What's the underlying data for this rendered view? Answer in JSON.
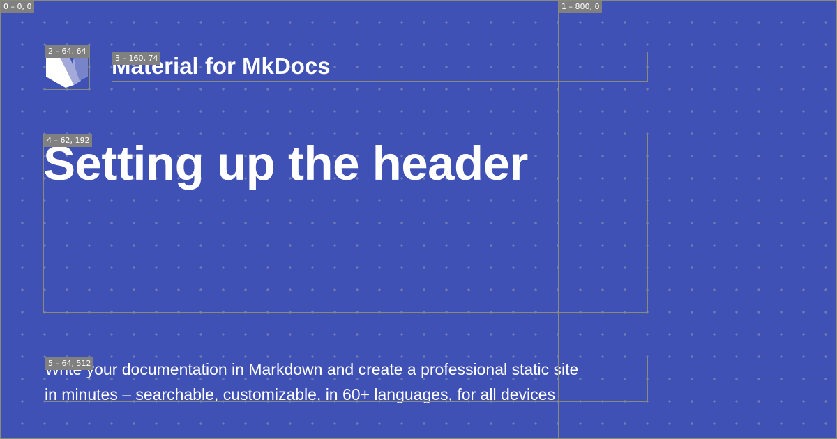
{
  "background_color": "#3f51b5",
  "site_name": "Material for MkDocs",
  "page_title": "Setting up the header",
  "description_lines": [
    "Write your documentation in Markdown and create a professional static site",
    "in minutes – searchable, customizable, in 60+ languages, for all devices"
  ],
  "logo": {
    "icon": "material-mkdocs-logo-icon"
  },
  "debug_labels": [
    "0 – 0, 0",
    "1 – 800, 0",
    "2 – 64, 64",
    "3 – 160, 74",
    "4 – 62, 192",
    "5 – 64, 512"
  ]
}
